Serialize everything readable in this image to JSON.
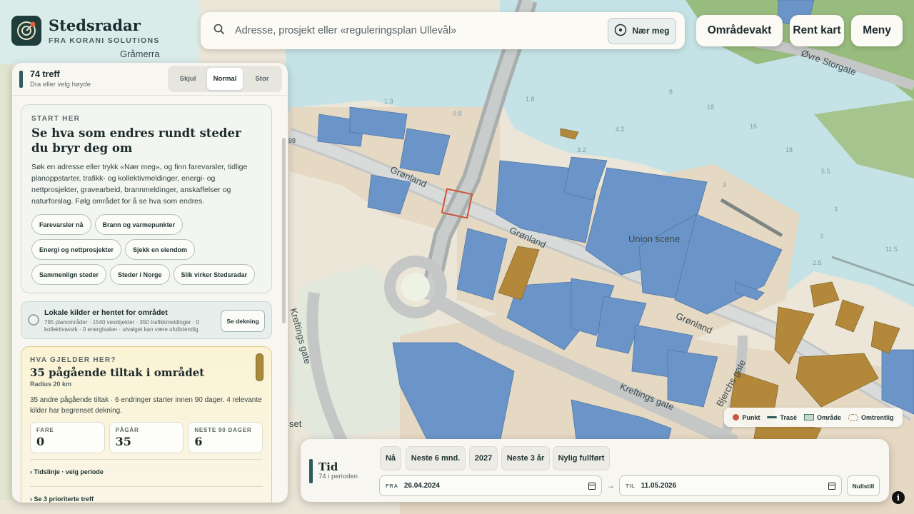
{
  "brand": {
    "title": "Stedsradar",
    "subtitle": "FRA KORANI SOLUTIONS"
  },
  "search": {
    "placeholder": "Adresse, prosjekt eller «reguleringsplan Ullevål»",
    "near_label": "Nær meg"
  },
  "top_buttons": {
    "area_watch": "Områdevakt",
    "clean_map": "Rent kart",
    "menu": "Meny"
  },
  "map": {
    "labels": {
      "gramerra": "Gråmerra",
      "ovre_storgate": "Øvre Storgate",
      "gronland_1": "Grønland",
      "gronland_2": "Grønland",
      "gronland_3": "Grønland",
      "union_scene": "Union scene",
      "kreftings_gate_1": "Kreftings gate",
      "kreftings_gate_2": "Kreftings gate",
      "bjerchs_gate": "Bjerchs gate",
      "set": "set",
      "num_98": "98"
    },
    "depths": [
      "1.3",
      "0.8",
      "1.8",
      "4.2",
      "8",
      "18",
      "16",
      "18",
      "5.5",
      "3",
      "3",
      "3",
      "11.5",
      "2.5",
      "4.2",
      "3.2"
    ]
  },
  "panel": {
    "hits": "74 treff",
    "hits_hint": "Dra eller velg høyde",
    "size_options": [
      "Skjul",
      "Normal",
      "Stor"
    ],
    "active_size": "Normal",
    "start": {
      "eyebrow": "START HER",
      "title": "Se hva som endres rundt steder du bryr deg om",
      "body": "Søk en adresse eller trykk «Nær meg», og finn farevarsler, tidlige planoppstarter, trafikk- og kollektivmeldinger, energi- og nettprosjekter, gravearbeid, brannmeldinger, anskaffelser og naturforslag. Følg området for å se hva som endres.",
      "chips": [
        "Farevarsler nå",
        "Brann og varmepunkter",
        "Energi og nettprosjekter",
        "Sjekk en eiendom",
        "Sammenlign steder",
        "Steder i Norge",
        "Slik virker Stedsradar"
      ]
    },
    "sources": {
      "title": "Lokale kilder er hentet for området",
      "detail": "795 planområder · 1540 veiobjekter · 350 trafikkmeldinger · 0 kollektivavvik · 0 energisaker · utvalget kan være ufullstendig",
      "button": "Se dekning"
    },
    "what": {
      "eyebrow": "HVA GJELDER HER?",
      "title": "35 pågående tiltak i området",
      "radius": "Radius 20 km",
      "body": "35 andre pågående tiltak · 6 endringer starter innen 90 dager. 4 relevante kilder har begrenset dekning.",
      "stats": [
        {
          "label": "FARE",
          "value": "0"
        },
        {
          "label": "PÅGÅR",
          "value": "35"
        },
        {
          "label": "NESTE 90 DAGER",
          "value": "6"
        }
      ],
      "expanders": [
        "Tidslinje · velg periode",
        "Se 3 prioriterte treff"
      ]
    }
  },
  "time": {
    "title": "Tid",
    "subtitle": "74 i perioden",
    "presets": [
      "Nå",
      "Neste 6 mnd.",
      "2027",
      "Neste 3 år",
      "Nylig fullført"
    ],
    "from_label": "FRA",
    "from_value": "26.04.2024",
    "to_label": "TIL",
    "to_value": "11.05.2026",
    "arrow": "→",
    "reset": "Nullstill"
  },
  "legend": {
    "point": "Punkt",
    "route": "Trasé",
    "area": "Område",
    "approx": "Omtrentlig"
  },
  "info": "i",
  "colors": {
    "water": "#c5e3e6",
    "land": "#ece6d8",
    "building": "#6b95c9",
    "building_gold": "#b3883a",
    "park": "#98bb7e",
    "road": "#c4c7c6",
    "accent": "#2d5c5b",
    "marker": "#c8573d"
  }
}
